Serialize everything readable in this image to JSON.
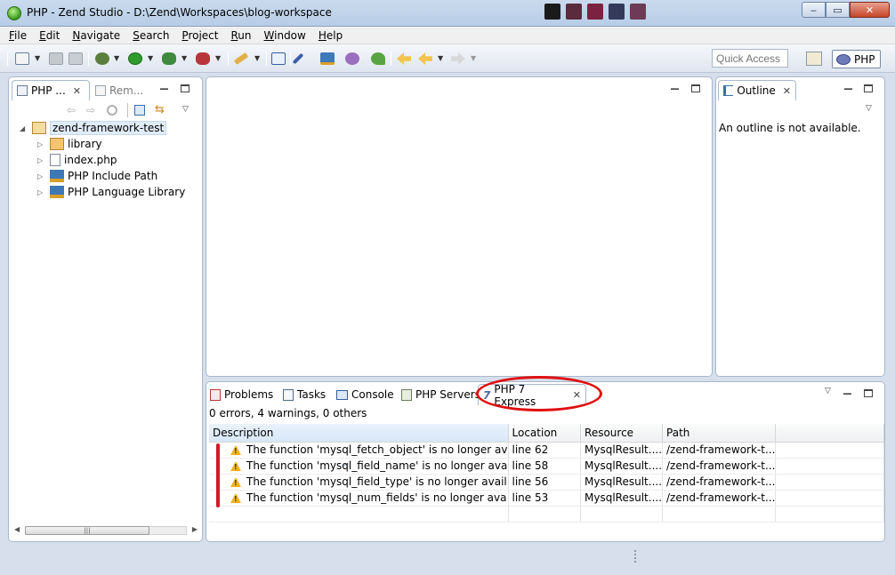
{
  "window": {
    "title": "PHP - Zend Studio - D:\\Zend\\Workspaces\\blog-workspace",
    "minimize": "‒",
    "maximize": "▭",
    "close": "✕"
  },
  "menu": [
    {
      "label": "File",
      "mnemonic": "F",
      "rest": "ile"
    },
    {
      "label": "Edit",
      "mnemonic": "E",
      "rest": "dit"
    },
    {
      "label": "Navigate",
      "mnemonic": "N",
      "rest": "avigate"
    },
    {
      "label": "Search",
      "mnemonic": "S",
      "rest": "earch"
    },
    {
      "label": "Project",
      "mnemonic": "P",
      "rest": "roject"
    },
    {
      "label": "Run",
      "mnemonic": "R",
      "rest": "un"
    },
    {
      "label": "Window",
      "mnemonic": "W",
      "rest": "indow"
    },
    {
      "label": "Help",
      "mnemonic": "H",
      "rest": "elp"
    }
  ],
  "toolbar": {
    "quick_access": "Quick Access",
    "perspective": "PHP"
  },
  "explorer": {
    "tabs": [
      {
        "label": "PHP ..."
      },
      {
        "label": "Rem..."
      }
    ],
    "tree": {
      "project": "zend-framework-test",
      "children": [
        {
          "label": "library"
        },
        {
          "label": "index.php"
        },
        {
          "label": "PHP Include Path"
        },
        {
          "label": "PHP Language Library"
        }
      ]
    },
    "scroll_thumb": "|||"
  },
  "outline": {
    "title": "Outline",
    "message": "An outline is not available."
  },
  "bottom": {
    "tabs": [
      {
        "label": "Problems"
      },
      {
        "label": "Tasks"
      },
      {
        "label": "Console"
      },
      {
        "label": "PHP Servers"
      },
      {
        "label": "PHP 7 Express"
      }
    ],
    "summary": "0 errors, 4 warnings, 0 others",
    "columns": [
      "Description",
      "Location",
      "Resource",
      "Path"
    ],
    "rows": [
      {
        "description": "The function 'mysql_fetch_object' is no longer av",
        "location": "line 62",
        "resource": "MysqlResult....",
        "path": "/zend-framework-t..."
      },
      {
        "description": "The function 'mysql_field_name' is no longer ava",
        "location": "line 58",
        "resource": "MysqlResult....",
        "path": "/zend-framework-t..."
      },
      {
        "description": "The function 'mysql_field_type' is no longer avail",
        "location": "line 56",
        "resource": "MysqlResult....",
        "path": "/zend-framework-t..."
      },
      {
        "description": "The function 'mysql_num_fields' is no longer ava",
        "location": "line 53",
        "resource": "MysqlResult....",
        "path": "/zend-framework-t..."
      }
    ]
  },
  "colors": {
    "annotation_red": "#e01010",
    "warning": "#f0b21c",
    "selection": "#e0ecf9"
  }
}
